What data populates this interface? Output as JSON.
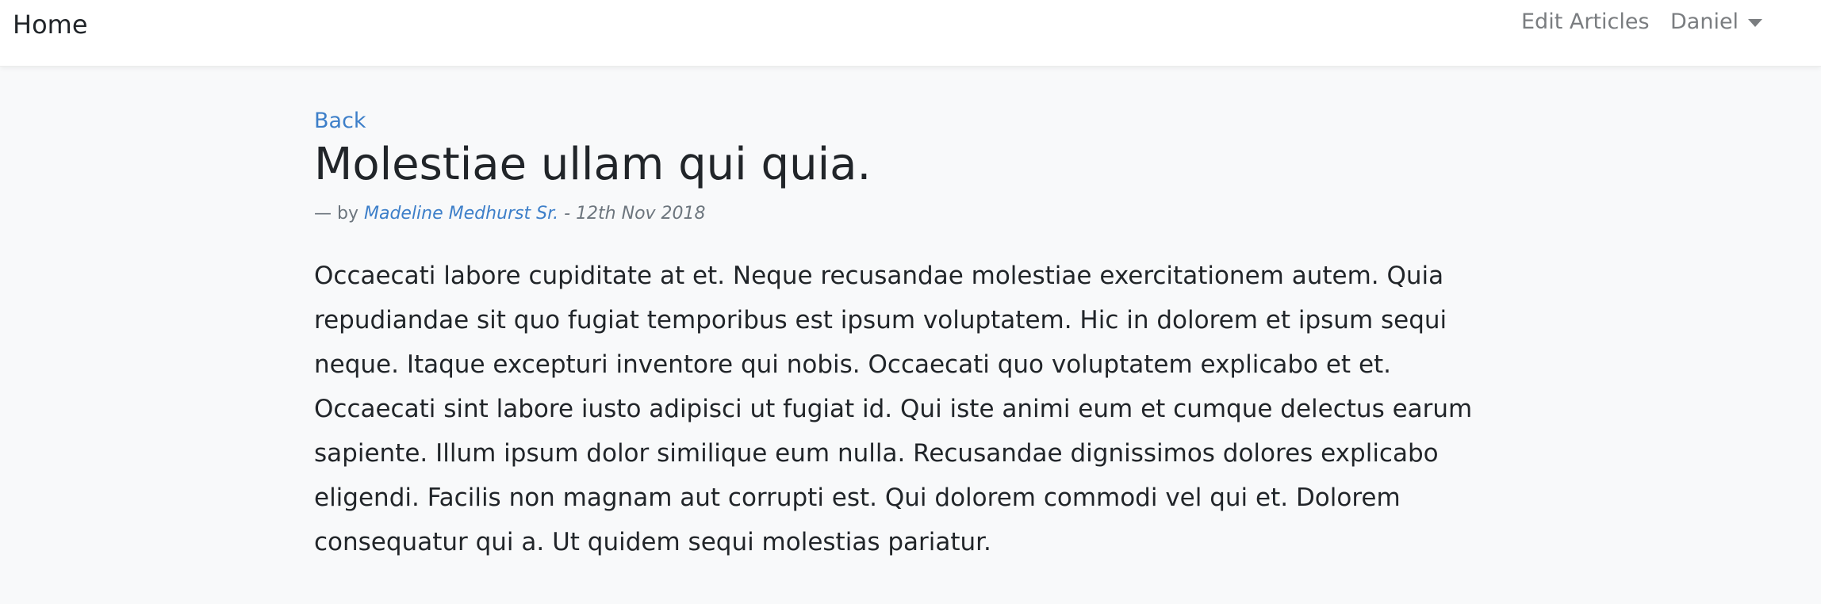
{
  "navbar": {
    "brand": "Home",
    "edit_articles": "Edit Articles",
    "user_name": "Daniel"
  },
  "article": {
    "back_label": "Back",
    "title": "Molestiae ullam qui quia.",
    "by_prefix": "— by",
    "author": "Madeline Medhurst Sr.",
    "date_sep": " - ",
    "date": "12th Nov 2018",
    "body": "Occaecati labore cupiditate at et. Neque recusandae molestiae exercitationem autem. Quia repudiandae sit quo fugiat temporibus est ipsum voluptatem. Hic in dolorem et ipsum sequi neque. Itaque excepturi inventore qui nobis. Occaecati quo voluptatem explicabo et et. Occaecati sint labore iusto adipisci ut fugiat id. Qui iste animi eum et cumque delectus earum sapiente. Illum ipsum dolor similique eum nulla. Recusandae dignissimos dolores explicabo eligendi. Facilis non magnam aut corrupti est. Qui dolorem commodi vel qui et. Dolorem consequatur qui a. Ut quidem sequi molestias pariatur."
  },
  "colors": {
    "link": "#3d7fc9",
    "nav_text": "#7a7d80",
    "background": "#f8f9fa"
  }
}
